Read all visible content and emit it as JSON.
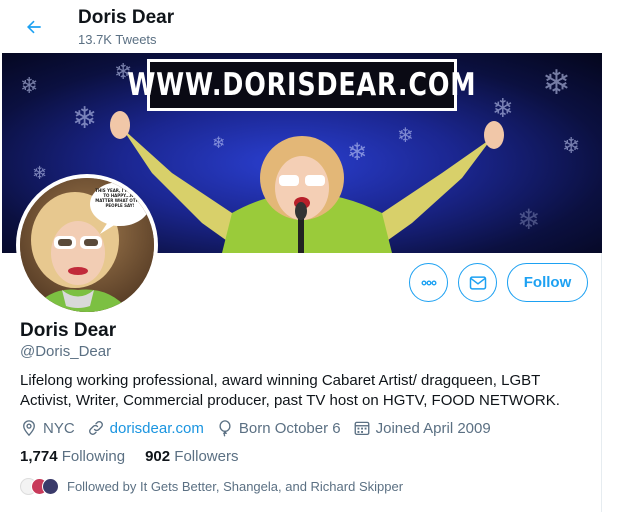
{
  "header": {
    "name": "Doris Dear",
    "tweet_count": "13.7K Tweets"
  },
  "banner": {
    "url_text": "WWW.DORISDEAR.COM"
  },
  "actions": {
    "more_icon": "more-horizontal-icon",
    "message_icon": "envelope-icon",
    "follow_label": "Follow"
  },
  "profile": {
    "name": "Doris Dear",
    "handle": "@Doris_Dear",
    "bio": "Lifelong working professional, award winning Cabaret Artist/ dragqueen, LGBT Activist, Writer, Commercial producer, past TV host on HGTV, FOOD NETWORK.",
    "location": "NYC",
    "website": "dorisdear.com",
    "birthday": "Born October 6",
    "joined": "Joined April 2009",
    "following_count": "1,774",
    "following_label": "Following",
    "followers_count": "902",
    "followers_label": "Followers",
    "followed_by": "Followed by It Gets Better, Shangela, and Richard Skipper"
  },
  "avatar_speech_bubble": "THIS YEAR, I'M GOING TO HAPPY...NO MATTER WHAT OTHER PEOPLE SAY!",
  "colors": {
    "accent": "#1da1f2",
    "link": "#1b95e0",
    "secondary_text": "#5b7083"
  }
}
